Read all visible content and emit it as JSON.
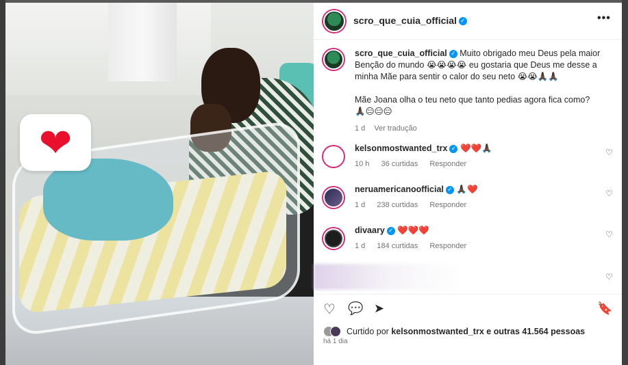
{
  "post": {
    "username": "scro_que_cuia_official",
    "more_label": "•••",
    "heart_badge": "❤"
  },
  "caption": {
    "username": "scro_que_cuia_official",
    "line1": "Muito obrigado meu Deus pela maior",
    "line2": "Benção do mundo 😭😭😭😭 eu gostaria que Deus me desse a",
    "line3": "minha Mãe para sentir o calor do seu neto 😭😭🙏🏿🙏🏿",
    "line4": "Mãe Joana olha o teu neto que tanto pedias agora fica como?",
    "line5": "🙏🏿😑😑😑",
    "time": "1 d",
    "translate": "Ver tradução"
  },
  "comments": [
    {
      "username": "kelsonmostwanted_trx",
      "text": "❤️❤️🙏🏿",
      "time": "10 h",
      "likes": "36 curtidas",
      "reply": "Responder"
    },
    {
      "username": "neruamericanoofficial",
      "text": "🙏🏿❤️",
      "time": "1 d",
      "likes": "238 curtidas",
      "reply": "Responder"
    },
    {
      "username": "divaary",
      "text": "❤️❤️❤️",
      "time": "1 d",
      "likes": "184 curtidas",
      "reply": "Responder"
    }
  ],
  "icons": {
    "heart": "♡",
    "comment": "💬",
    "share": "➤",
    "save": "🔖"
  },
  "liked_by": {
    "prefix": "Curtido por",
    "user": "kelsonmostwanted_trx",
    "suffix": "e outras 41.564 pessoas"
  },
  "timestamp": "há 1 dia"
}
